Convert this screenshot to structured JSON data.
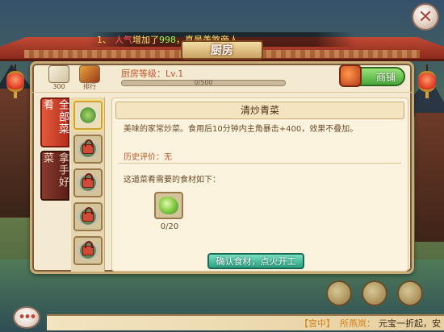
{
  "notice": {
    "index": "1、",
    "part1": "人气",
    "part2": "增加了",
    "amount": "998",
    "part3": "，真是羡煞旁人"
  },
  "window_title": "厨房",
  "header": {
    "chart_icon_label": "300",
    "rank_icon_label": "排行",
    "level_label": "厨房等级：Lv.1",
    "exp_text": "0/500",
    "exp_progress": 0,
    "shop_label": "商铺"
  },
  "categories": [
    {
      "label": "全部菜肴",
      "active": true
    },
    {
      "label": "拿手好菜",
      "active": false
    }
  ],
  "dish": {
    "name": "清炒青菜",
    "description": "美味的家常炒菜。食用后10分钟内主角暴击+400，效果不叠加。",
    "history": "历史评价：无",
    "ingredients_hint": "这道菜肴需要的食材如下：",
    "ingredient_count": "0/20",
    "confirm_label": "确认食材，点火开工"
  },
  "chat": {
    "channel": "【宫中】",
    "sender": "所燕岚：",
    "message": "元宝一折起，安"
  },
  "icons": {
    "close": "close-icon",
    "shop": "treasure-chest-icon",
    "chat": "chat-bubble-icon"
  }
}
